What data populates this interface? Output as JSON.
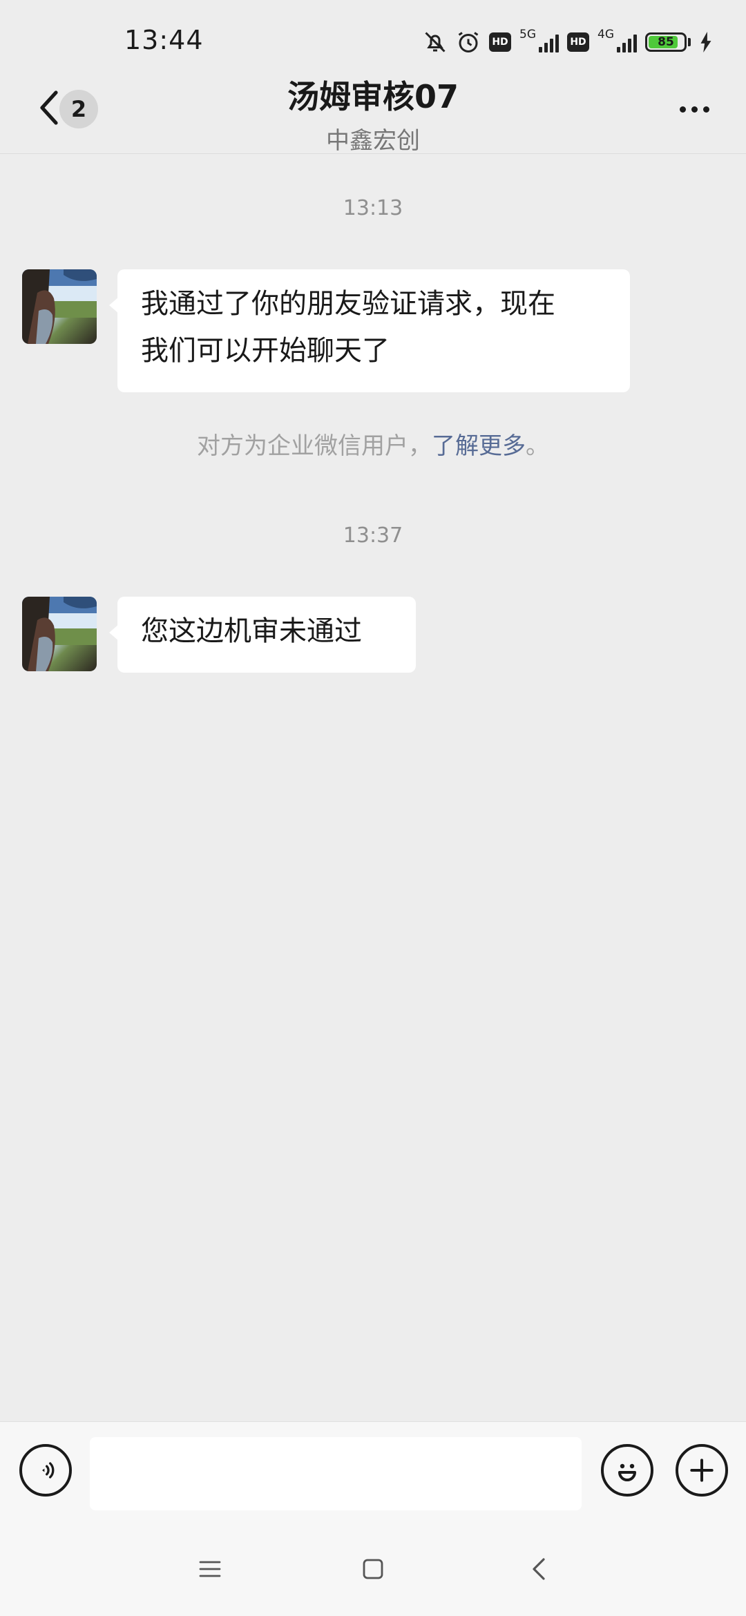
{
  "status_bar": {
    "time": "13:44",
    "icons": [
      "bell-off-icon",
      "alarm-icon",
      "hd-icon",
      "signal-5g-icon",
      "hd-icon",
      "signal-4g-icon",
      "battery-icon",
      "charging-icon"
    ],
    "network_1": "5G",
    "network_2": "4G",
    "hd_label": "HD",
    "battery_level": 85,
    "battery_text": "85",
    "battery_color": "#4fc93a"
  },
  "header": {
    "unread_count": "2",
    "title": "汤姆审核07",
    "subtitle": "中鑫宏创"
  },
  "messages": [
    {
      "timestamp": "13:13",
      "text_line1": "我通过了你的朋友验证请求，现在",
      "text_line2": "我们可以开始聊天了"
    },
    {
      "notice_text": "对方为企业微信用户，",
      "notice_link": "了解更多",
      "notice_end": "。"
    },
    {
      "timestamp": "13:37",
      "text": "您这边机审未通过"
    }
  ],
  "input_bar": {
    "value": "",
    "icons": [
      "voice-icon",
      "emoji-icon",
      "plus-icon"
    ]
  },
  "nav_bar": {
    "icons": [
      "menu-icon",
      "home-icon",
      "back-icon"
    ]
  },
  "colors": {
    "background": "#ededed",
    "bubble": "#ffffff",
    "link": "#576b95",
    "timestamp": "#8f8f8f"
  }
}
